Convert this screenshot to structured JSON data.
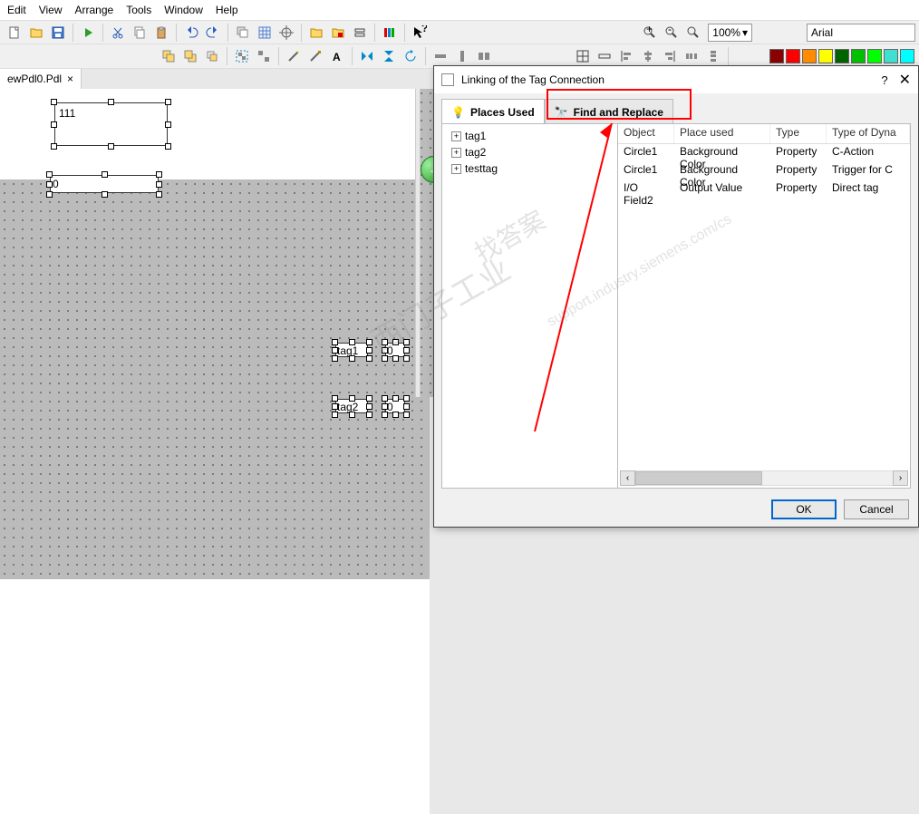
{
  "menu": {
    "edit": "Edit",
    "view": "View",
    "arrange": "Arrange",
    "tools": "Tools",
    "window": "Window",
    "help": "Help"
  },
  "zoom": {
    "value": "100%"
  },
  "font": {
    "name": "Arial"
  },
  "tab": {
    "name": "ewPdl0.Pdl",
    "close": "×"
  },
  "canvas": {
    "field1": "111",
    "field2": "0",
    "tag1_label": "tag1",
    "tag1_val": "0",
    "tag2_label": "tag2",
    "tag2_val": "0"
  },
  "dialog": {
    "title": "Linking of the Tag Connection",
    "help": "?",
    "close": "✕",
    "tabs": {
      "places": "Places Used",
      "find": "Find and Replace"
    },
    "tree": {
      "t1": "tag1",
      "t2": "tag2",
      "t3": "testtag",
      "exp": "+"
    },
    "cols": {
      "obj": "Object",
      "place": "Place used",
      "type": "Type",
      "dyn": "Type of Dyna"
    },
    "rows": {
      "0": {
        "obj": "Circle1",
        "place": "Background Color",
        "type": "Property",
        "dyn": "C-Action"
      },
      "1": {
        "obj": "Circle1",
        "place": "Background Color",
        "type": "Property",
        "dyn": "Trigger for C"
      },
      "2": {
        "obj": "I/O Field2",
        "place": "Output Value",
        "type": "Property",
        "dyn": "Direct tag"
      }
    },
    "footer": {
      "ok": "OK",
      "cancel": "Cancel"
    },
    "scroll": {
      "left": "‹",
      "right": "›"
    }
  },
  "colors": {
    "dark_red": "#8b0000",
    "red": "#ff0000",
    "orange": "#ff8c00",
    "yellow": "#ffff00",
    "dark_green": "#006400",
    "green": "#00c000",
    "lime": "#00ff00",
    "teal": "#40e0d0",
    "cyan": "#00ffff"
  },
  "back_arrow": "←"
}
